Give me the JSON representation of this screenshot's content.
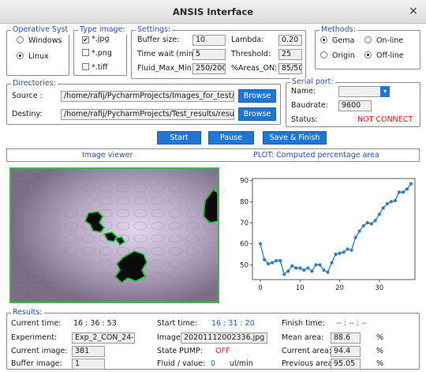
{
  "window": {
    "title": "ANSIS Interface",
    "close_glyph": "×"
  },
  "os": {
    "legend": "Operative Syst",
    "options": [
      {
        "label": "Windows",
        "selected": false
      },
      {
        "label": "Linux",
        "selected": true
      }
    ]
  },
  "image_type": {
    "legend": "Type image:",
    "options": [
      {
        "label": "*.jpg",
        "checked": true
      },
      {
        "label": "*.png",
        "checked": false
      },
      {
        "label": "*.tiff",
        "checked": false
      }
    ]
  },
  "settings": {
    "legend": "Settings:",
    "buffer_size": {
      "label": "Buffer size:",
      "value": "10"
    },
    "lambda": {
      "label": "Lambda:",
      "value": "0.20"
    },
    "time_wait": {
      "label": "Time wait (min):",
      "value": "5"
    },
    "threshold": {
      "label": "Threshold:",
      "value": "25"
    },
    "fluid_max_min": {
      "label": "Fluid_Max_Min",
      "value": "250/200"
    },
    "areas_on": {
      "label": "%Areas_ON:",
      "value": "85/50"
    }
  },
  "methods": {
    "legend": "Methods:",
    "options": [
      {
        "label": "Gema",
        "selected": true
      },
      {
        "label": "On-line",
        "selected": false
      },
      {
        "label": "Origin",
        "selected": false
      },
      {
        "label": "Off-line",
        "selected": true
      }
    ]
  },
  "directories": {
    "legend": "Directories:",
    "source": {
      "label": "Source :",
      "value": "/home/rafij/PycharmProjects/Images_for_test/Exp_2_CON_24-72",
      "browse_label": "Browse"
    },
    "destiny": {
      "label": "Destiny:",
      "value": "/home/rafij/PycharmProjects/Test_results/results3",
      "browse_label": "Browse"
    }
  },
  "serial_port": {
    "legend": "Serial port:",
    "name_label": "Name:",
    "name_value": "",
    "baudrate_label": "Baudrate:",
    "baudrate_value": "9600",
    "status_label": "Status:",
    "status_value": "NOT CONNECT"
  },
  "actions": {
    "start": "Start",
    "pause": "Pause",
    "save_finish": "Save & Finish"
  },
  "panels": {
    "image_viewer": "Image viewer",
    "plot_title": "PLOT: Computed percentage area"
  },
  "chart_data": {
    "type": "line",
    "title": "",
    "xlabel": "",
    "ylabel": "",
    "xlim": [
      -2,
      39
    ],
    "ylim": [
      43,
      91
    ],
    "xticks": [
      0,
      10,
      20,
      30
    ],
    "yticks": [
      50,
      60,
      70,
      80,
      90
    ],
    "color": "#2e7dc0",
    "x": [
      0,
      1,
      2,
      3,
      4,
      5,
      6,
      7,
      8,
      9,
      10,
      11,
      12,
      13,
      14,
      15,
      16,
      17,
      18,
      19,
      20,
      21,
      22,
      23,
      24,
      25,
      26,
      27,
      28,
      29,
      30,
      31,
      32,
      33,
      34,
      35,
      36,
      37,
      38
    ],
    "y": [
      60,
      52.5,
      50.5,
      51,
      52,
      52,
      45.5,
      47,
      49.5,
      48.5,
      48.5,
      47.5,
      48.5,
      47,
      50,
      50,
      47.5,
      46.5,
      51,
      55,
      55.5,
      56,
      57.5,
      57,
      63,
      66,
      68.5,
      70,
      69.5,
      71,
      74,
      77,
      79,
      80,
      80.5,
      84.5,
      84.5,
      86,
      88.5
    ]
  },
  "results": {
    "legend": "Results:",
    "current_time": {
      "label": "Current time:",
      "value": "16 : 36 : 53"
    },
    "start_time": {
      "label": "Start time:",
      "value": "16 : 31 : 20"
    },
    "finish_time": {
      "label": "Finish time:",
      "value": "-- : -- : --"
    },
    "experiment": {
      "label": "Experiment:",
      "value": "Exp_2_CON_24-72"
    },
    "image": {
      "label": "Image:",
      "value": "20201112002336.jpg"
    },
    "mean_area": {
      "label": "Mean area:",
      "value": "88.6",
      "unit": "%"
    },
    "current_image": {
      "label": "Current image:",
      "value": "381"
    },
    "state_pump": {
      "label": "State PUMP:",
      "value": "OFF"
    },
    "current_area": {
      "label": "Current area:",
      "value": "94.4",
      "unit": "%"
    },
    "buffer_image": {
      "label": "Buffer image:",
      "value": "1"
    },
    "fluid_value": {
      "label": "Fluid / value:",
      "value": "0",
      "unit": "ul/min"
    },
    "previous_area": {
      "label": "Previous area:",
      "value": "95.05",
      "unit": "%"
    }
  },
  "colors": {
    "accent_blue": "#1f76d4",
    "legend_blue": "#2a50b8",
    "status_red": "#e02020",
    "viewer_border": "#4caf50",
    "detection_green": "#00cc33"
  }
}
